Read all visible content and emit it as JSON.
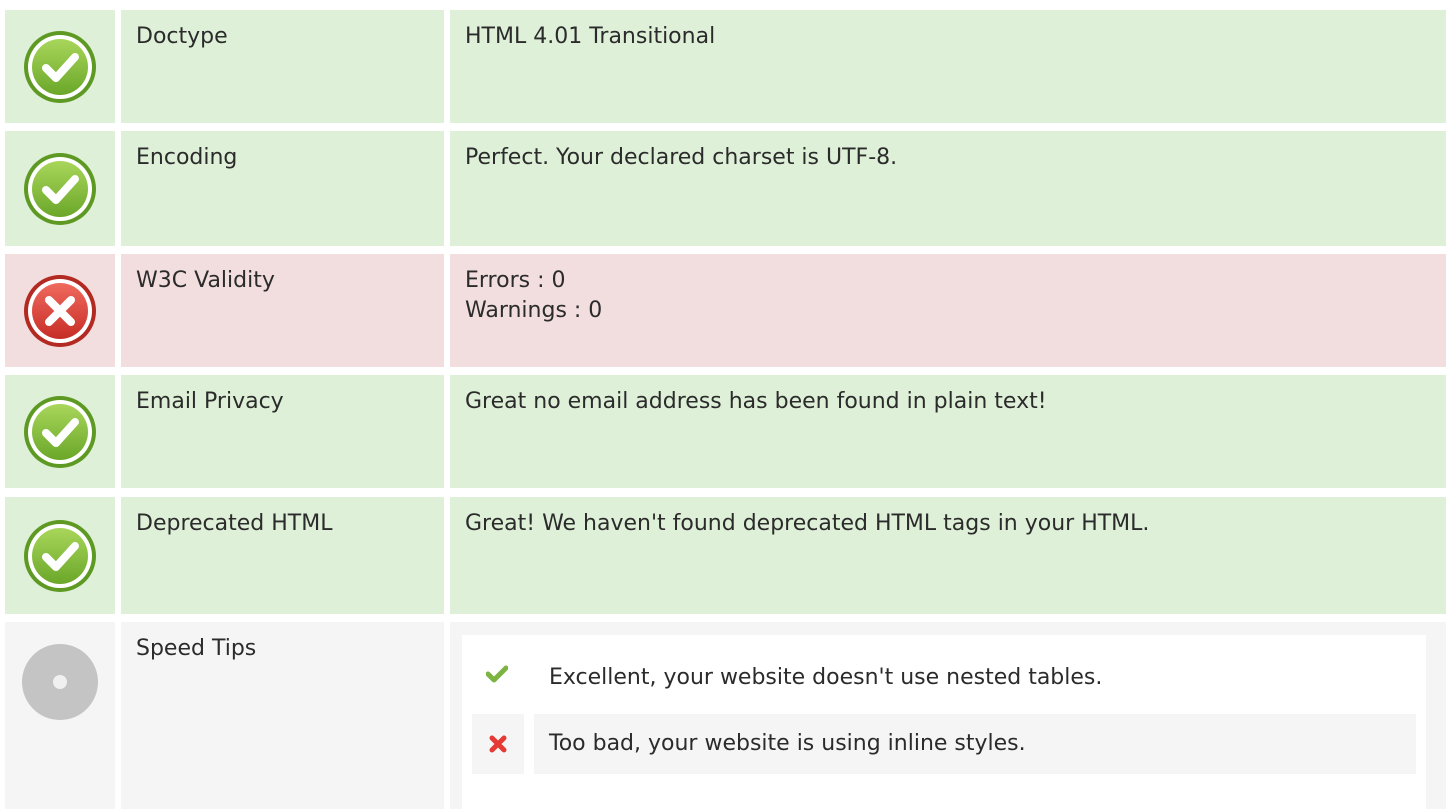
{
  "checks": [
    {
      "status": "good",
      "label": "Doctype",
      "lines": [
        "HTML 4.01 Transitional"
      ]
    },
    {
      "status": "good",
      "label": "Encoding",
      "lines": [
        "Perfect. Your declared charset is UTF-8."
      ]
    },
    {
      "status": "bad",
      "label": "W3C Validity",
      "lines": [
        "Errors : 0",
        "Warnings : 0"
      ]
    },
    {
      "status": "good",
      "label": "Email Privacy",
      "lines": [
        "Great no email address has been found in plain text!"
      ]
    },
    {
      "status": "good",
      "label": "Deprecated HTML",
      "lines": [
        "Great! We haven't found deprecated HTML tags in your HTML."
      ]
    }
  ],
  "speed_tips": {
    "status": "neutral",
    "label": "Speed Tips",
    "tips": [
      {
        "status": "good",
        "text": "Excellent, your website doesn't use nested tables."
      },
      {
        "status": "bad",
        "text": "Too bad, your website is using inline styles."
      }
    ]
  },
  "icons": {
    "good": "check-circle-icon",
    "bad": "cross-circle-icon",
    "neutral": "neutral-circle-icon",
    "tip_good": "check-mark-icon",
    "tip_bad": "x-mark-icon"
  },
  "colors": {
    "good_bg": "#dff0d8",
    "bad_bg": "#f2dede",
    "neutral_bg": "#f5f5f5",
    "good_icon": "#8cc63f",
    "bad_icon": "#e0443e",
    "neutral_icon": "#c4c4c4"
  }
}
